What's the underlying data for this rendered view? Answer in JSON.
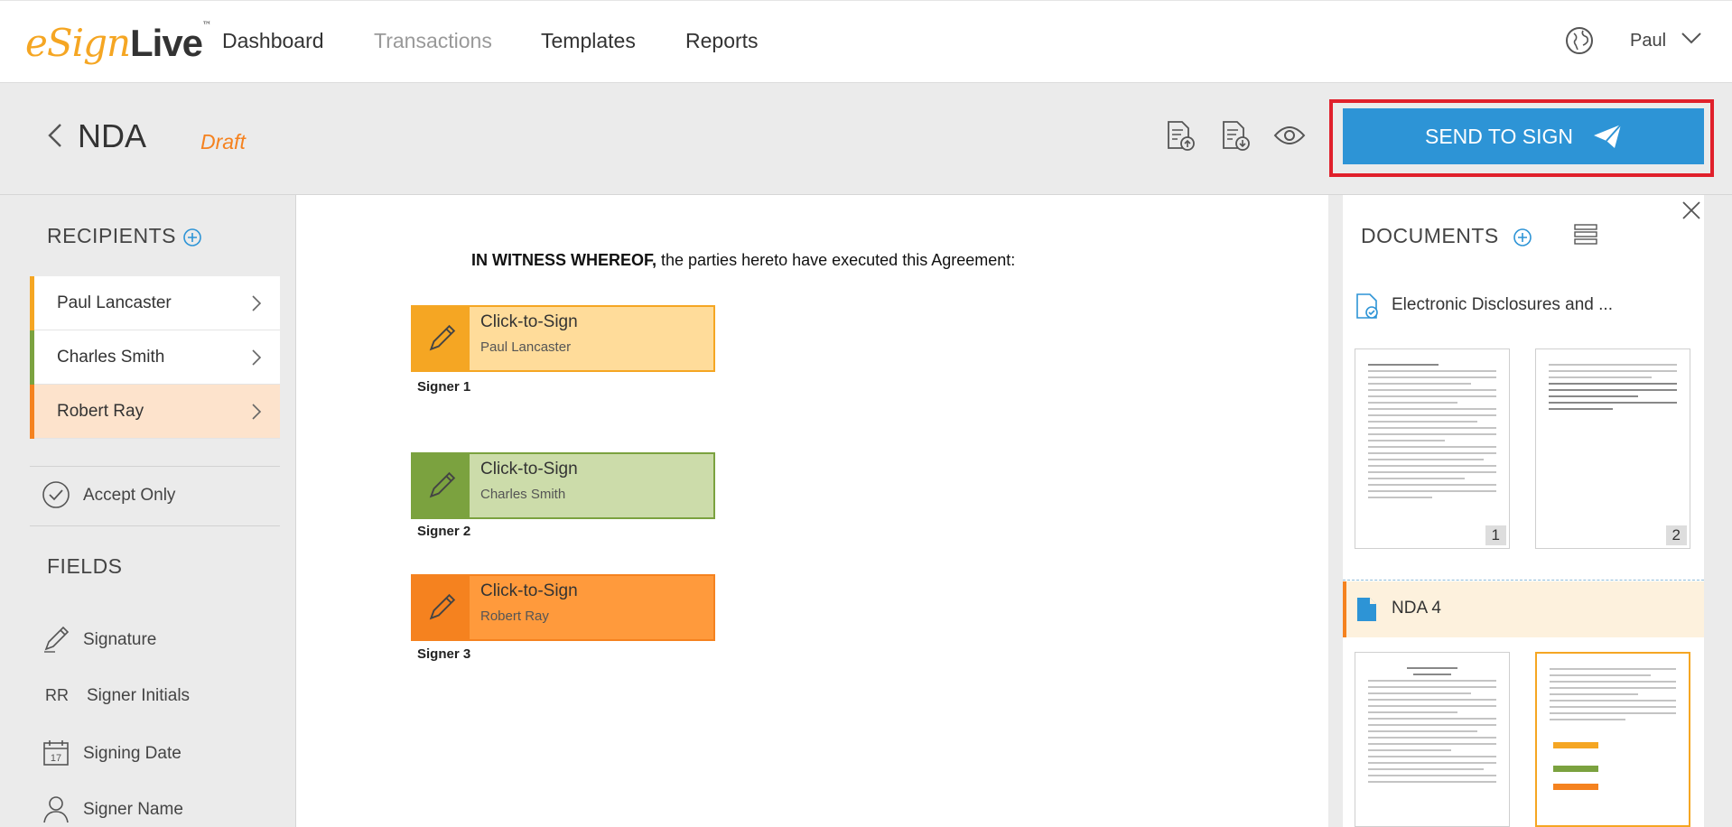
{
  "brand": {
    "e": "e",
    "sign": "Sign",
    "live": "Live",
    "tm": "™"
  },
  "nav": {
    "dashboard": "Dashboard",
    "transactions": "Transactions",
    "templates": "Templates",
    "reports": "Reports",
    "user": "Paul"
  },
  "header": {
    "title": "NDA",
    "status": "Draft",
    "send_label": "SEND TO SIGN"
  },
  "recipients": {
    "title": "RECIPIENTS",
    "items": [
      {
        "name": "Paul Lancaster",
        "color": "#f5a623"
      },
      {
        "name": "Charles Smith",
        "color": "#7ba23f"
      },
      {
        "name": "Robert Ray",
        "color": "#f5821f"
      }
    ],
    "accept_only": "Accept Only"
  },
  "fields": {
    "title": "FIELDS",
    "items": [
      {
        "label": "Signature",
        "icon": "pen-icon"
      },
      {
        "label": "Signer Initials",
        "icon": "initials-icon",
        "badge": "RR"
      },
      {
        "label": "Signing Date",
        "icon": "calendar-icon",
        "badge": "17"
      },
      {
        "label": "Signer Name",
        "icon": "person-icon"
      }
    ]
  },
  "document": {
    "witness_bold": "IN WITNESS WHEREOF,",
    "witness_rest": " the parties hereto have executed this Agreement:",
    "signatures": [
      {
        "action": "Click-to-Sign",
        "name": "Paul Lancaster",
        "label": "Signer 1"
      },
      {
        "action": "Click-to-Sign",
        "name": "Charles Smith",
        "label": "Signer 2"
      },
      {
        "action": "Click-to-Sign",
        "name": "Robert Ray",
        "label": "Signer 3"
      }
    ]
  },
  "documents_panel": {
    "title": "DOCUMENTS",
    "docs": [
      {
        "name": "Electronic Disclosures and ...",
        "pages": [
          "1",
          "2"
        ]
      },
      {
        "name": "NDA 4"
      }
    ]
  },
  "colors": {
    "accent": "#2d94d6",
    "highlight": "#e0202b",
    "draft": "#f5821f"
  }
}
